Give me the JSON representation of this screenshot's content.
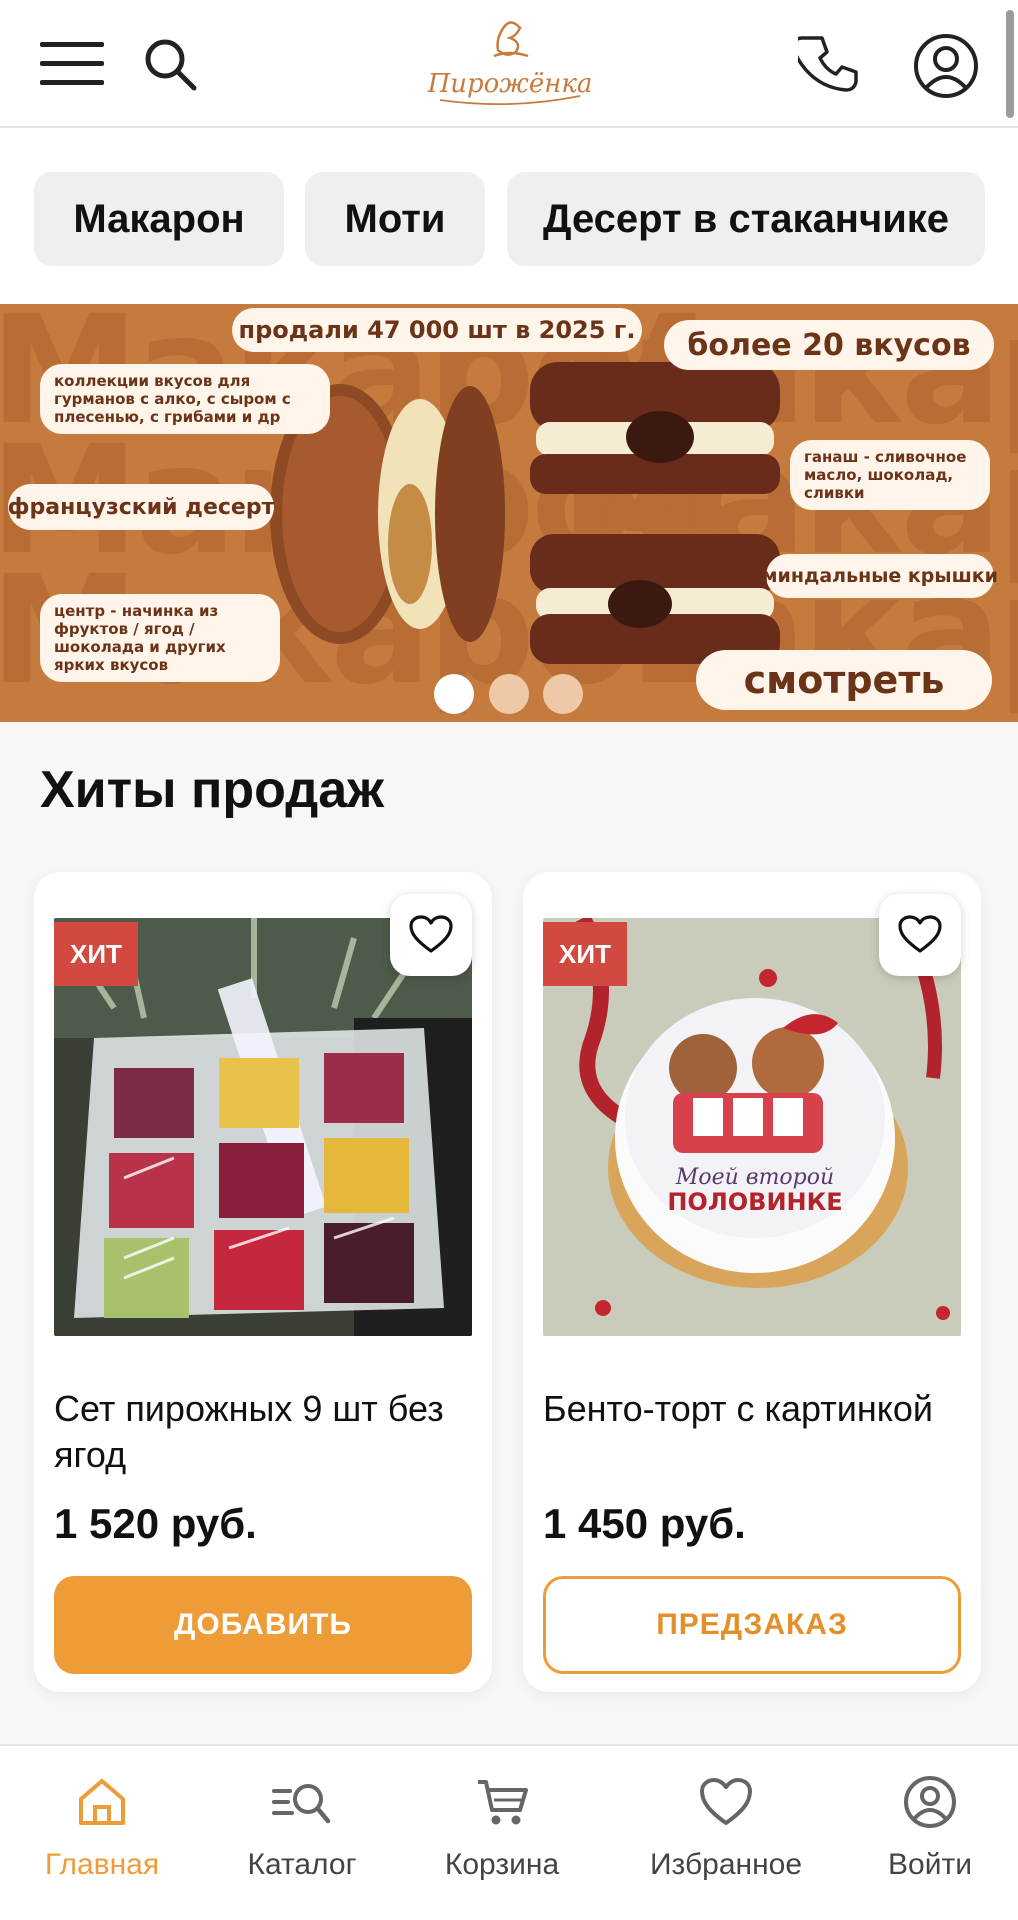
{
  "header": {
    "logo_text": "Пирожёнка",
    "icons": [
      "menu-icon",
      "search-icon",
      "phone-icon",
      "account-icon"
    ]
  },
  "categories": [
    {
      "label": "Макарон"
    },
    {
      "label": "Моти"
    },
    {
      "label": "Десерт в стаканчике"
    }
  ],
  "banner": {
    "background_word": "Макарон",
    "sold": "продали 47 000 шт в 2025 г.",
    "flavors": "более 20 вкусов",
    "collections": "коллекции вкусов для гурманов с алко, с сыром с плесенью, с грибами и др",
    "french": "французский десерт",
    "center": "центр - начинка из фруктов / ягод / шоколада и других ярких вкусов",
    "ganache": "ганаш - сливочное масло, шоколад, сливки",
    "shells": "миндальные крышки",
    "cta": "смотреть",
    "slides": 3,
    "active_slide": 1
  },
  "section": {
    "title": "Хиты продаж"
  },
  "products": [
    {
      "badge": "ХИТ",
      "name": "Сет пирожных 9 шт без ягод",
      "price": "1 520 руб.",
      "button": "ДОБАВИТЬ",
      "button_style": "solid"
    },
    {
      "badge": "ХИТ",
      "name": "Бенто-торт с картинкой",
      "price": "1 450 руб.",
      "button": "ПРЕДЗАКАЗ",
      "button_style": "outline",
      "image_caption": "Моей второй ПОЛОВИНКЕ"
    }
  ],
  "bottom_nav": [
    {
      "label": "Главная",
      "icon": "home-icon",
      "active": true
    },
    {
      "label": "Каталог",
      "icon": "catalog-search-icon",
      "active": false
    },
    {
      "label": "Корзина",
      "icon": "cart-icon",
      "active": false
    },
    {
      "label": "Избранное",
      "icon": "heart-icon",
      "active": false
    },
    {
      "label": "Войти",
      "icon": "account-icon",
      "active": false
    }
  ],
  "colors": {
    "accent": "#ee9c37",
    "badge": "#d24940",
    "banner": "#c57a3e",
    "logo": "#c97a3c"
  }
}
